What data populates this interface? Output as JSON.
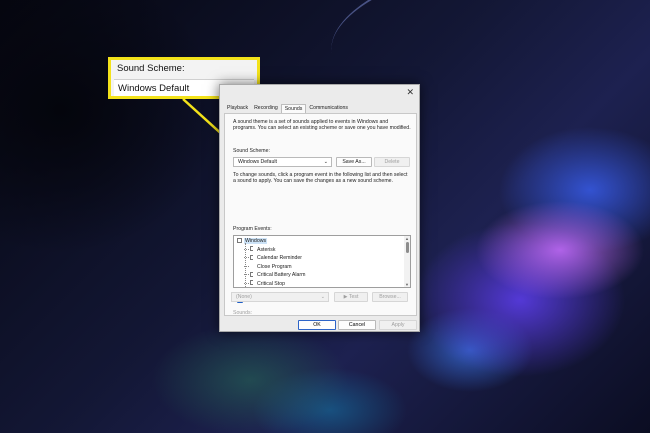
{
  "callout": {
    "title": "Sound Scheme:",
    "value": "Windows Default"
  },
  "dialog": {
    "close_glyph": "✕",
    "tabs": [
      "Playback",
      "Recording",
      "Sounds",
      "Communications"
    ],
    "active_tab": "Sounds",
    "description": "A sound theme is a set of sounds applied to events in Windows and programs.  You can select an existing scheme or save one you have modified.",
    "scheme_label": "Sound Scheme:",
    "scheme_value": "Windows Default",
    "save_as_label": "Save As...",
    "delete_label": "Delete",
    "change_desc": "To change sounds, click a program event in the following list and then select a sound to apply.  You can save the changes as a new sound scheme.",
    "program_events_label": "Program Events:",
    "events_root": "Windows",
    "events": [
      "Asterisk",
      "Calendar Reminder",
      "Close Program",
      "Critical Battery Alarm",
      "Critical Stop"
    ],
    "startup_checkbox_label": "Play Windows Startup sound",
    "startup_checked": true,
    "sounds_label": "Sounds:",
    "sounds_value": "(None)",
    "test_label": "Test",
    "browse_label": "Browse...",
    "ok_label": "OK",
    "cancel_label": "Cancel",
    "apply_label": "Apply"
  },
  "colors": {
    "callout_border": "#f3e21a",
    "checkbox_accent": "#1f5fc7",
    "selection": "#cde3f7"
  }
}
